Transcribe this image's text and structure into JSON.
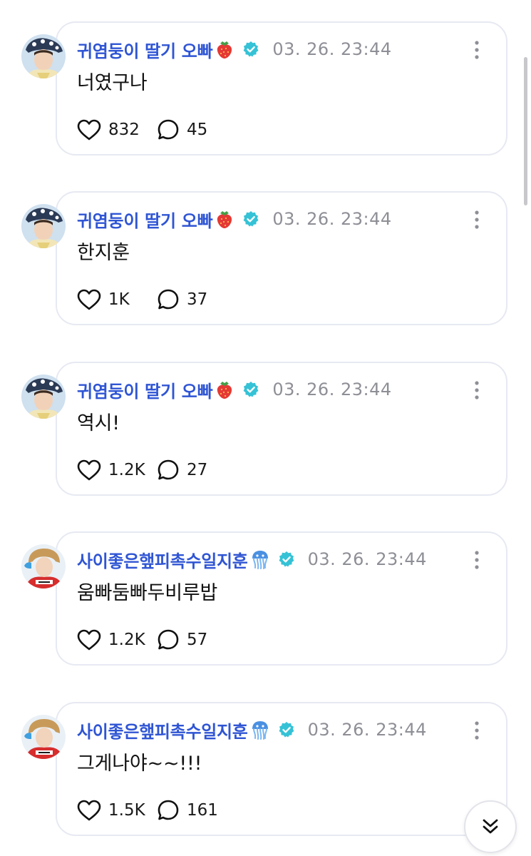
{
  "colors": {
    "author": "#2f55d4",
    "timestamp": "#8e8f96",
    "verified": "#35c2d6",
    "card_border": "#e7e9f2"
  },
  "icons": {
    "like": "heart-outline-icon",
    "comment": "speech-bubble-icon",
    "more": "kebab-menu-icon",
    "verified": "verified-badge-icon",
    "scroll_down": "double-chevron-down-icon"
  },
  "posts": [
    {
      "author": "귀염둥이 딸기 오빠",
      "badge_emoji": "strawberry-icon",
      "timestamp": "03. 26. 23:44",
      "content": "너였구나",
      "likes": "832",
      "comments": "45"
    },
    {
      "author": "귀염둥이 딸기 오빠",
      "badge_emoji": "strawberry-icon",
      "timestamp": "03. 26. 23:44",
      "content": "한지훈",
      "likes": "1K",
      "comments": "37"
    },
    {
      "author": "귀염둥이 딸기 오빠",
      "badge_emoji": "strawberry-icon",
      "timestamp": "03. 26. 23:44",
      "content": "역시!",
      "likes": "1.2K",
      "comments": "27"
    },
    {
      "author": "사이좋은햎피촉수일지훈",
      "badge_emoji": "jellyfish-icon",
      "timestamp": "03. 26. 23:44",
      "content": "움빠둠빠두비루밥",
      "likes": "1.2K",
      "comments": "57"
    },
    {
      "author": "사이좋은햎피촉수일지훈",
      "badge_emoji": "jellyfish-icon",
      "timestamp": "03. 26. 23:44",
      "content": "그게나야~~!!!",
      "likes": "1.5K",
      "comments": "161"
    }
  ]
}
